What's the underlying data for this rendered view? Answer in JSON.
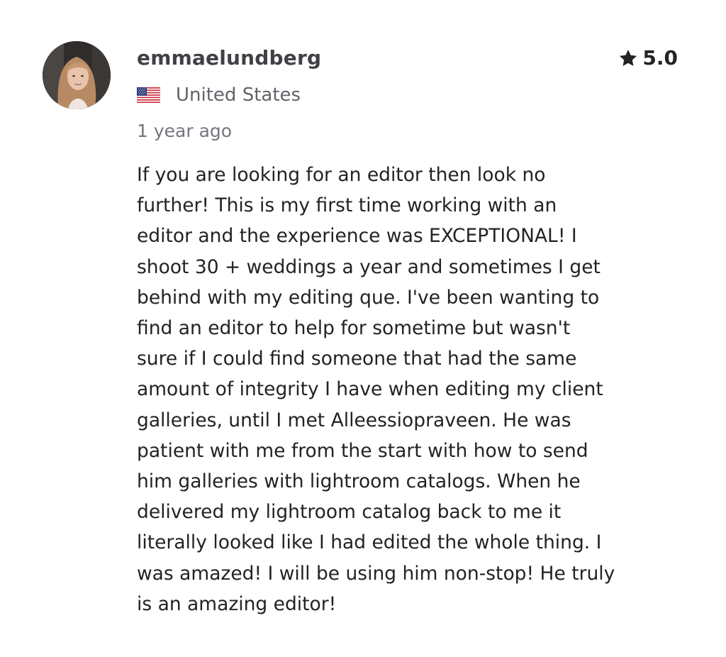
{
  "reviewer": {
    "username": "emmaelundberg",
    "avatar": "profile-photo",
    "country": "United States",
    "flag": "us-flag-icon",
    "time_ago": "1 year ago"
  },
  "rating": {
    "icon": "star-icon",
    "value": "5.0"
  },
  "review": {
    "text": "If you are looking for an editor then look no\nfurther! This is my first time working with an\neditor and the experience was EXCEPTIONAL! I\nshoot 30 + weddings a year and sometimes I get\nbehind with my editing que. I've been wanting to\nfind an editor to help for sometime but wasn't\nsure if I could find someone that had the same\namount of integrity I have when editing my client\ngalleries, until I met Alleessiopraveen. He was\npatient with me from the start with how to send\nhim galleries with lightroom catalogs. When he\ndelivered my lightroom catalog back to me it\nliterally looked like I had edited the whole thing. I\nwas amazed! I will be using him non-stop! He truly\nis an amazing editor!"
  },
  "colors": {
    "username": "#404145",
    "text": "#222325",
    "muted": "#74767e",
    "star": "#222325"
  }
}
